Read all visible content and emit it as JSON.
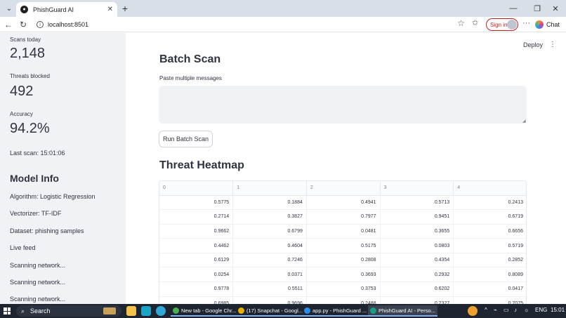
{
  "browser": {
    "tab_title": "PhishGuard AI",
    "url": "localhost:8501",
    "signin_label": "Sign in",
    "chat_label": "Chat"
  },
  "sidebar": {
    "metrics": [
      {
        "label": "Scans today",
        "value": "2,148"
      },
      {
        "label": "Threats blocked",
        "value": "492"
      },
      {
        "label": "Accuracy",
        "value": "94.2%"
      }
    ],
    "last_scan": "Last scan: 15:01:06",
    "model_heading": "Model Info",
    "model_lines": [
      "Algorithm: Logistic Regression",
      "Vectorizer: TF-IDF",
      "Dataset: phishing samples",
      "Live feed",
      "Scanning network...",
      "Scanning network...",
      "Scanning network..."
    ]
  },
  "main": {
    "deploy_label": "Deploy",
    "batch_title": "Batch Scan",
    "textarea_label": "Paste multiple messages",
    "run_button": "Run Batch Scan",
    "heatmap_title": "Threat Heatmap",
    "table": {
      "columns": [
        "0",
        "1",
        "2",
        "3",
        "4"
      ],
      "rows": [
        [
          "0.5775",
          "0.1884",
          "0.4941",
          "0.5713",
          "0.2413"
        ],
        [
          "0.2714",
          "0.3827",
          "0.7977",
          "0.9451",
          "0.6719"
        ],
        [
          "0.9662",
          "0.6799",
          "0.0481",
          "0.3655",
          "0.6656"
        ],
        [
          "0.4462",
          "0.4604",
          "0.5175",
          "0.0803",
          "0.5719"
        ],
        [
          "0.6129",
          "0.7246",
          "0.2808",
          "0.4354",
          "0.2852"
        ],
        [
          "0.0254",
          "0.0371",
          "0.3693",
          "0.2932",
          "0.8089"
        ],
        [
          "0.9778",
          "0.5511",
          "0.3753",
          "0.6202",
          "0.0417"
        ],
        [
          "0.6985",
          "0.9696",
          "0.2488",
          "0.2327",
          "0.7075"
        ]
      ]
    }
  },
  "taskbar": {
    "search_label": "Search",
    "apps": [
      {
        "label": "New tab - Google Chr...",
        "color": "#4caf50"
      },
      {
        "label": "(17) Snapchat - Googl...",
        "color": "#e8b100"
      },
      {
        "label": "app.py - PhishGuard ...",
        "color": "#2d8ceb"
      },
      {
        "label": "PhishGuard AI - Perso...",
        "color": "#16a085"
      }
    ],
    "language": "ENG",
    "time": "15:01"
  }
}
